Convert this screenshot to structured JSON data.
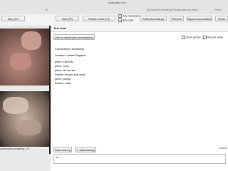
{
  "browser": {
    "url": "chatroulette.com",
    "tab_left": "Ch",
    "tab_right": "Elle Sucks Ex Friends By Faceink Avec Un Lange Et Beau...",
    "tab_forum": "Forum"
  },
  "toolbar": {
    "stop_label": "Stop (F3)",
    "next_label": "Next (F2)",
    "report_label": "Report & next (F4)",
    "auto_reconnect_label": "Auto reconnect",
    "auto_start_label": "Auto start",
    "profile_label": "Profile and settings",
    "premium_label": "Premium",
    "support_label": "Support and contacts",
    "forum_label": "Forum"
  },
  "chat": {
    "title": "Text chat",
    "view_report_label": "View or report past conversations",
    "show_partner_label": "Show partner",
    "receive_audio_label": "Receive audio",
    "messages": [
      "Connected to somebody",
      "Location: United Kingdom",
      "pierre: HUUUM",
      "pierre: sexy",
      "pierre: let me see",
      "Partner: let you see what",
      "pierre: pussy",
      "Partner: okay"
    ],
    "clear_label": "Clear chat log",
    "start_drawing_label": "Start drawing",
    "font_size_label": "Font siz",
    "composer_text": "ntj"
  },
  "status": {
    "connections_text": "connections remaining: 171"
  }
}
